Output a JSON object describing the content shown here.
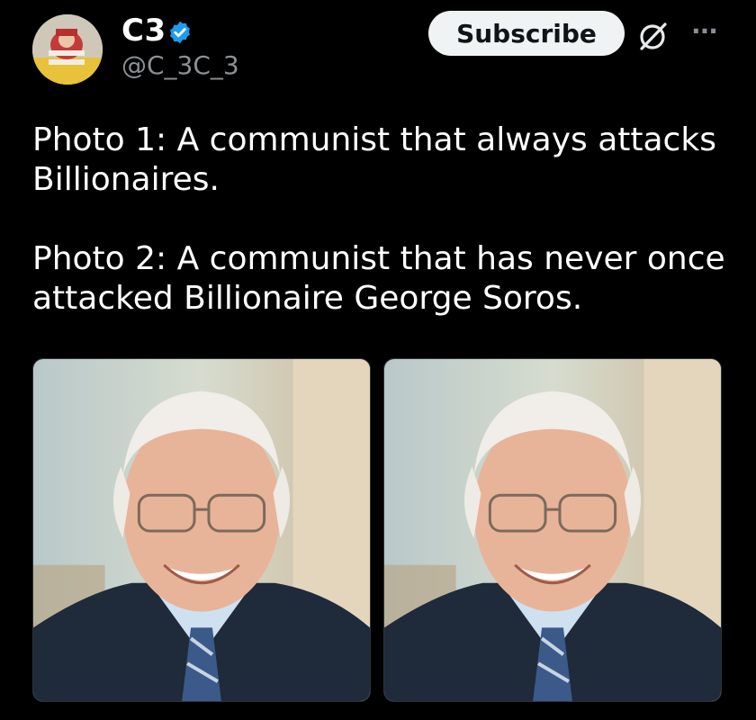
{
  "post": {
    "author": {
      "display_name": "C3",
      "handle": "@C_3C_3",
      "verified": true,
      "avatar_icon": "avatar-image"
    },
    "actions": {
      "subscribe_label": "Subscribe",
      "grok_icon": "grok-icon",
      "more_icon": "more-options-icon",
      "more_glyph": "···"
    },
    "text": {
      "paragraph_1": "Photo 1: A communist that always attacks Billionaires.",
      "paragraph_2": "Photo 2: A communist that has never once attacked Billionaire George Soros."
    },
    "media": [
      {
        "name": "photo-1"
      },
      {
        "name": "photo-2"
      }
    ]
  },
  "colors": {
    "background": "#000000",
    "text_primary": "#ffffff",
    "text_secondary": "#8b9096",
    "verified_badge": "#1d9bf0",
    "subscribe_bg": "#eff3f4",
    "subscribe_text": "#0f1419"
  }
}
